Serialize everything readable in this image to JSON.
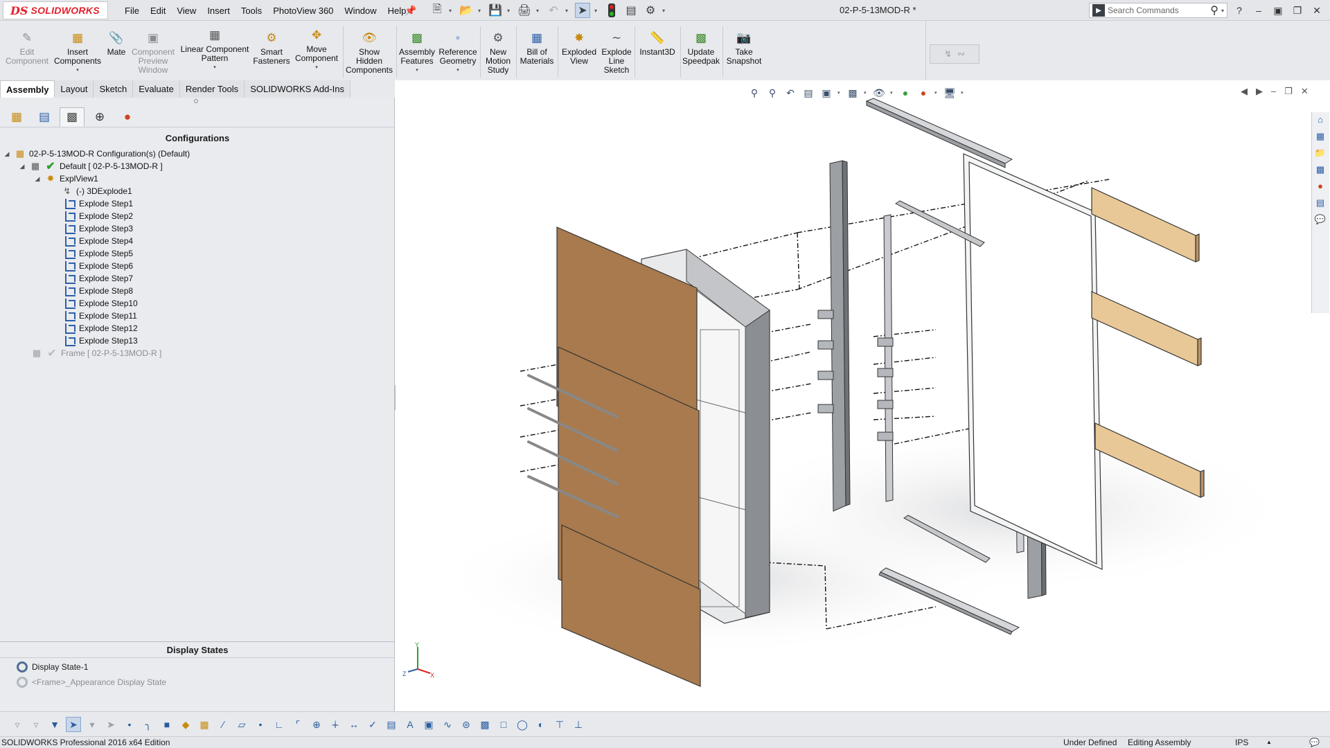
{
  "app": {
    "logo_mark": "DS",
    "logo_text": "SOLIDWORKS",
    "document_title": "02-P-5-13MOD-R *",
    "search_placeholder": "Search Commands",
    "help_label": "?"
  },
  "menu": [
    "File",
    "Edit",
    "View",
    "Insert",
    "Tools",
    "PhotoView 360",
    "Window",
    "Help"
  ],
  "ribbon": {
    "edit_component": [
      "Edit",
      "Component"
    ],
    "insert_components": [
      "Insert",
      "Components"
    ],
    "mate": [
      "Mate"
    ],
    "component_preview_window": [
      "Component",
      "Preview",
      "Window"
    ],
    "linear_component_pattern": [
      "Linear Component",
      "Pattern"
    ],
    "smart_fasteners": [
      "Smart",
      "Fasteners"
    ],
    "move_component": [
      "Move",
      "Component"
    ],
    "show_hidden_components": [
      "Show",
      "Hidden",
      "Components"
    ],
    "assembly_features": [
      "Assembly",
      "Features"
    ],
    "reference_geometry": [
      "Reference",
      "Geometry"
    ],
    "new_motion_study": [
      "New",
      "Motion",
      "Study"
    ],
    "bill_of_materials": [
      "Bill of",
      "Materials"
    ],
    "exploded_view": [
      "Exploded",
      "View"
    ],
    "explode_line_sketch": [
      "Explode",
      "Line",
      "Sketch"
    ],
    "instant3d": [
      "Instant3D"
    ],
    "update_speedpak": [
      "Update",
      "Speedpak"
    ],
    "take_snapshot": [
      "Take",
      "Snapshot"
    ]
  },
  "tabs": [
    {
      "label": "Assembly",
      "active": true
    },
    {
      "label": "Layout",
      "active": false
    },
    {
      "label": "Sketch",
      "active": false
    },
    {
      "label": "Evaluate",
      "active": false
    },
    {
      "label": "Render Tools",
      "active": false
    },
    {
      "label": "SOLIDWORKS Add-Ins",
      "active": false
    }
  ],
  "config_manager": {
    "title": "Configurations",
    "root": "02-P-5-13MOD-R Configuration(s)  (Default)",
    "default_config": "Default [ 02-P-5-13MOD-R ]",
    "explview": "ExplView1",
    "explode_3d": "(-) 3DExplode1",
    "steps": [
      "Explode Step1",
      "Explode Step2",
      "Explode Step3",
      "Explode Step4",
      "Explode Step5",
      "Explode Step6",
      "Explode Step7",
      "Explode Step8",
      "Explode Step10",
      "Explode Step11",
      "Explode Step12",
      "Explode Step13"
    ],
    "frame_config": "Frame [ 02-P-5-13MOD-R ]"
  },
  "display_states": {
    "title": "Display States",
    "items": [
      {
        "label": "Display State-1",
        "active": true
      },
      {
        "label": "<Frame>_Appearance Display State",
        "active": false
      }
    ]
  },
  "triad": {
    "x": "X",
    "y": "Y",
    "z": "Z"
  },
  "status": {
    "edition": "SOLIDWORKS Professional 2016 x64 Edition",
    "definition": "Under Defined",
    "mode": "Editing Assembly",
    "units": "IPS"
  },
  "colors": {
    "logo_red": "#e3202c",
    "accent_blue": "#2d5fa8",
    "check_green": "#2aa02a",
    "panel_wood": "#a87a4e",
    "shelf_wood": "#e8c896",
    "frame_gray": "#b4b7bb"
  }
}
